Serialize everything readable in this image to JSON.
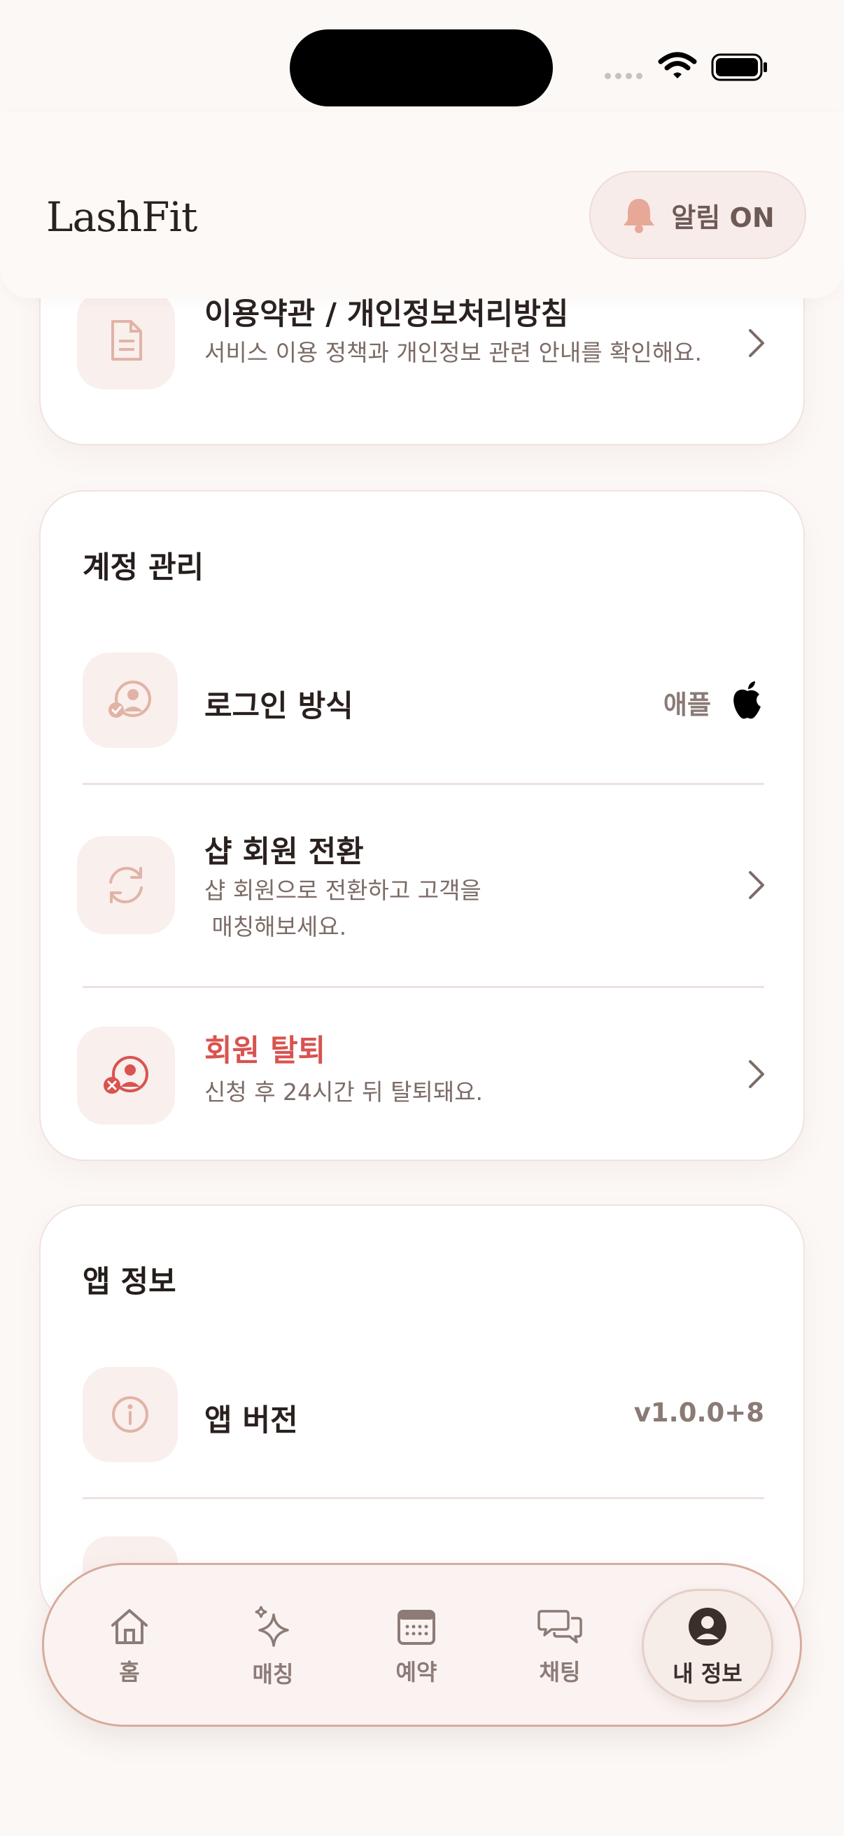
{
  "app": {
    "title": "LashFit"
  },
  "header": {
    "notify_label": "알림 ON"
  },
  "policy_card": {
    "title": "이용약관 / 개인정보처리방침",
    "desc": "서비스 이용 정책과 개인정보 관련 안내를 확인해요."
  },
  "account": {
    "section_title": "계정 관리",
    "login": {
      "title": "로그인 방식",
      "value": "애플"
    },
    "convert": {
      "title": "샵 회원 전환",
      "desc_line1": "샵 회원으로 전환하고 고객을",
      "desc_line2": " 매칭해보세요."
    },
    "withdraw": {
      "title": "회원 탈퇴",
      "desc": "신청 후 24시간 뒤 탈퇴돼요."
    }
  },
  "app_info": {
    "section_title": "앱 정보",
    "version": {
      "title": "앱 버전",
      "value": "v1.0.0+8"
    }
  },
  "nav": {
    "items": [
      {
        "label": "홈",
        "icon": "home-icon"
      },
      {
        "label": "매칭",
        "icon": "sparkle-icon"
      },
      {
        "label": "예약",
        "icon": "calendar-icon"
      },
      {
        "label": "채팅",
        "icon": "chat-icon"
      },
      {
        "label": "내 정보",
        "icon": "profile-icon",
        "active": true
      }
    ]
  },
  "colors": {
    "accent": "#d4a091",
    "danger": "#d9534f",
    "background": "#fcf8f6"
  }
}
